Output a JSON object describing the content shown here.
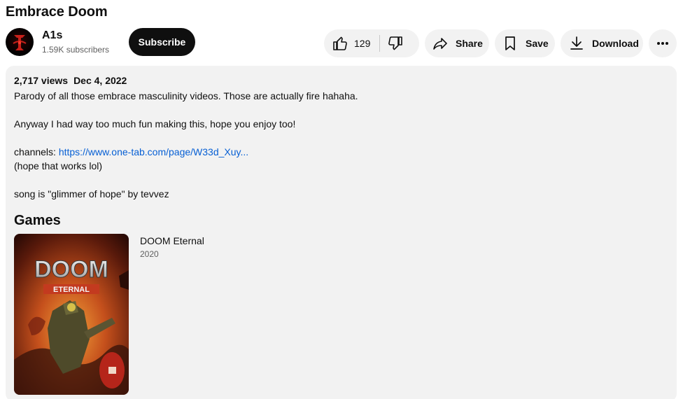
{
  "video": {
    "title": "Embrace Doom"
  },
  "channel": {
    "name": "A1s",
    "subscribers": "1.59K subscribers",
    "subscribe_label": "Subscribe"
  },
  "actions": {
    "like_count": "129",
    "share_label": "Share",
    "save_label": "Save",
    "download_label": "Download"
  },
  "description": {
    "views": "2,717 views",
    "date": "Dec 4, 2022",
    "line1": "Parody of all those embrace masculinity videos. Those are actually fire hahaha.",
    "line2": "Anyway I had way too much fun making this, hope you enjoy too!",
    "channels_prefix": "channels: ",
    "channels_link": "https://www.one-tab.com/page/W33d_Xuy...",
    "line4": "(hope that works lol)",
    "line5": "song is \"glimmer of hope\" by tevvez"
  },
  "games": {
    "heading": "Games",
    "items": [
      {
        "title": "DOOM Eternal",
        "year": "2020",
        "cover_logo": "DOOM",
        "cover_sublogo": "ETERNAL"
      }
    ]
  },
  "colors": {
    "link": "#065fd4",
    "panel": "#f2f2f2",
    "subscribe_bg": "#0f0f0f"
  },
  "icons": [
    "thumbs-up-icon",
    "thumbs-down-icon",
    "share-arrow-icon",
    "bookmark-icon",
    "download-icon",
    "more-horizontal-icon"
  ]
}
